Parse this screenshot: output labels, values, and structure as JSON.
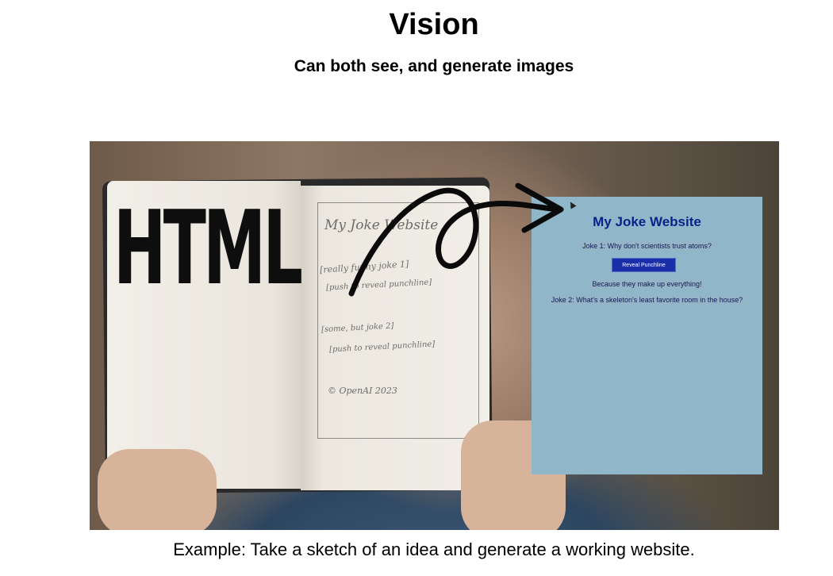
{
  "header": {
    "title": "Vision",
    "subtitle": "Can both see, and generate images"
  },
  "illustration": {
    "overlay_word": "HTML",
    "sketch": {
      "heading": "My Joke Website",
      "line1": "[really funny joke 1]",
      "line2": "[push to reveal punchline]",
      "line3": "[some, but joke 2]",
      "line4": "[push to reveal punchline]",
      "signature": "© OpenAI 2023"
    },
    "website": {
      "title": "My Joke Website",
      "joke1": "Joke 1: Why don't scientists trust atoms?",
      "button_label": "Reveal Punchline",
      "punchline1": "Because they make up everything!",
      "joke2": "Joke 2: What's a skeleton's least favorite room in the house?"
    }
  },
  "caption": "Example: Take a sketch of an idea and generate a working website.",
  "colors": {
    "website_background": "#8fb6c9",
    "website_title": "#0a1f8a",
    "button": "#1a2ea8"
  }
}
